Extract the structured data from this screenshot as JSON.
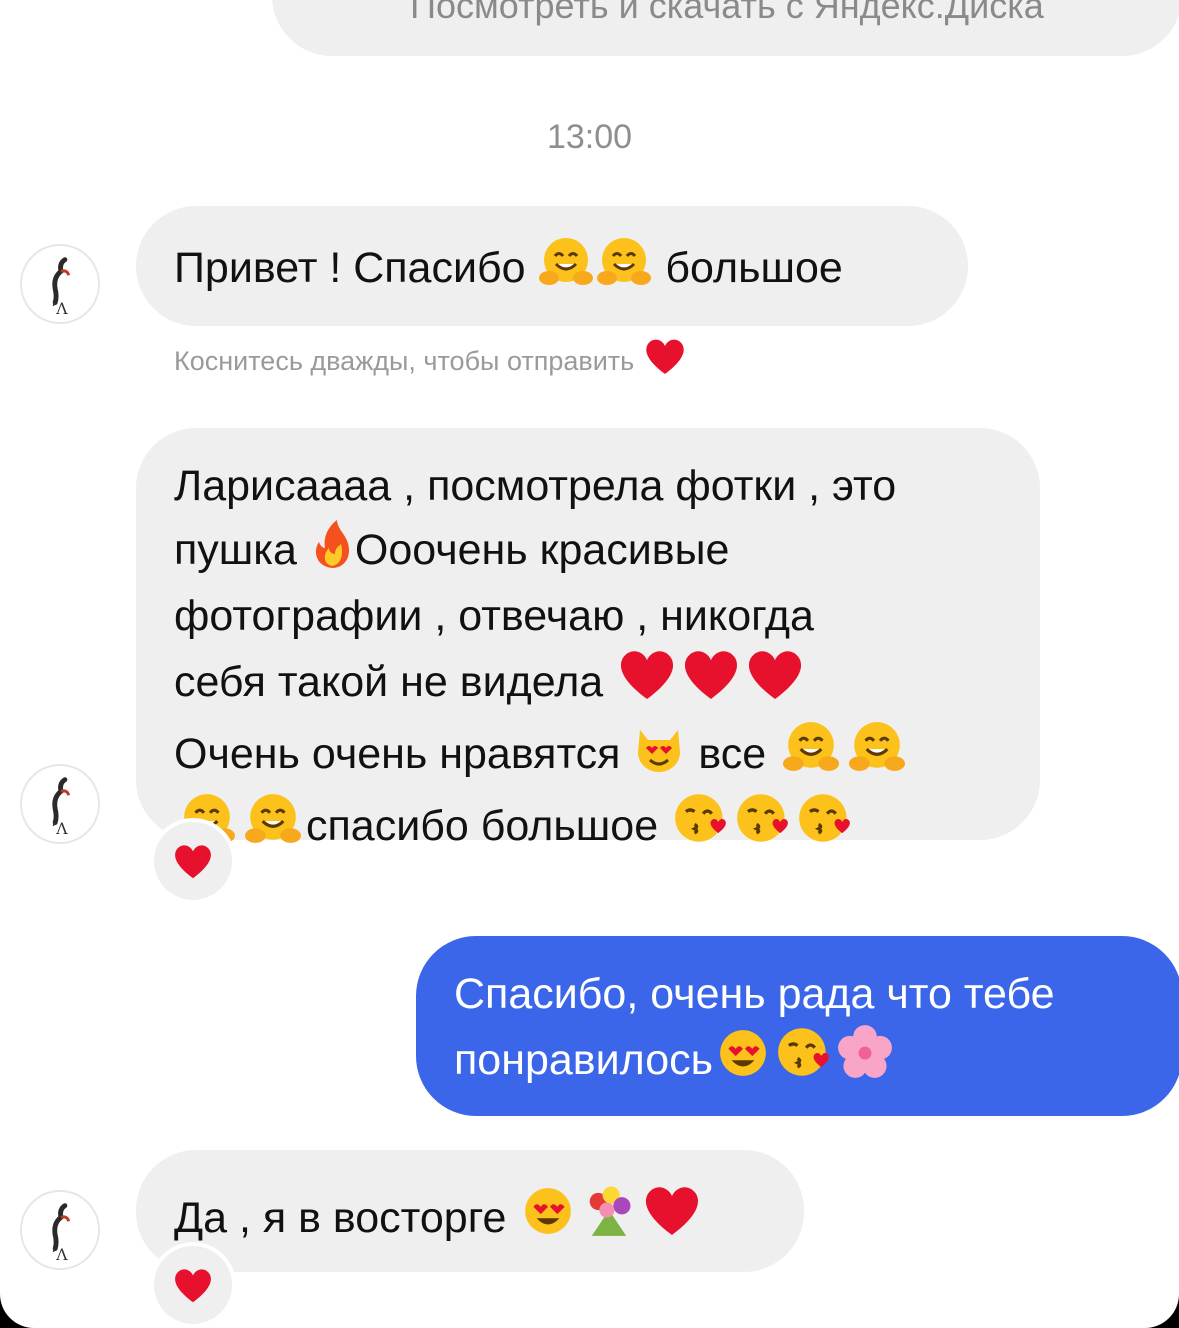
{
  "top_message": {
    "text": "Посмотреть и скачать с Яндекс.Диска"
  },
  "timestamp": "13:00",
  "messages": [
    {
      "direction": "incoming",
      "lines": [
        "Привет ! Спасибо 🤗🤗 большое"
      ],
      "parts": {
        "a": "Привет ! Спасибо ",
        "b": " большое"
      }
    },
    {
      "direction": "incoming",
      "parts": {
        "l1": "Ларисаааа , посмотрела фотки , это",
        "l2a": "пушка ",
        "l2b": "Ооочень красивые",
        "l3": "фотографии , отвечаю , никогда",
        "l4": "себя такой не видела ",
        "l5a": "Очень очень нравятся ",
        "l5b": " все ",
        "l6": "спасибо большое "
      },
      "reaction": "heart"
    },
    {
      "direction": "outgoing",
      "parts": {
        "l1": "Спасибо, очень рада что тебе",
        "l2": "понравилось"
      }
    },
    {
      "direction": "incoming",
      "parts": {
        "a": "Да , я в восторге "
      },
      "reaction": "heart"
    }
  ],
  "hint_text": "Коснитесь дважды, чтобы отправить",
  "icons": [
    "hugging-face",
    "fire",
    "red-heart",
    "heart-eyes-cat",
    "face-blowing-kiss",
    "heart-eyes-face",
    "cherry-blossom",
    "bouquet"
  ],
  "colors": {
    "outgoing_bubble": "#3c66ea",
    "incoming_bubble": "#efefef",
    "heart": "#e8112d"
  }
}
